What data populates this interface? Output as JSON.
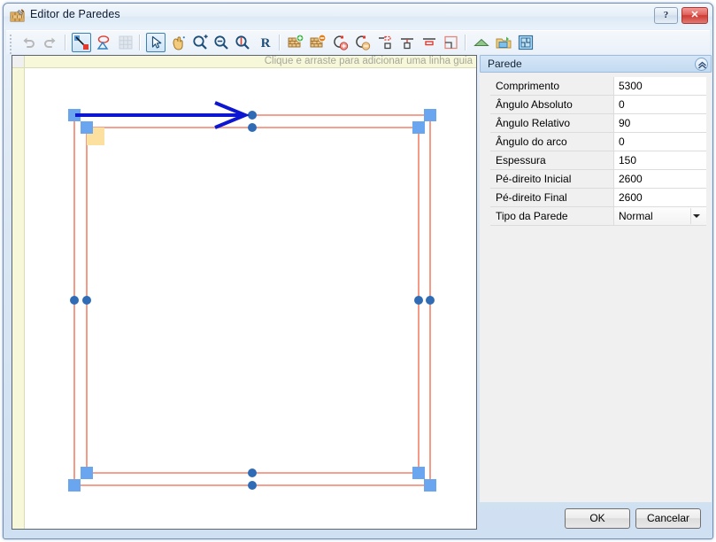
{
  "window": {
    "title": "Editor de Paredes",
    "icon": "brick-wall-icon",
    "help_label": "?",
    "close_label": "✕"
  },
  "toolbar": {
    "buttons": [
      {
        "name": "undo-button",
        "tip": "Desfazer",
        "selected": false
      },
      {
        "name": "redo-button",
        "tip": "Refazer",
        "selected": false
      },
      {
        "name": "draw-wall-button",
        "tip": "Desenhar parede",
        "selected": true
      },
      {
        "name": "draw-polygon-button",
        "tip": "Desenhar polígono",
        "selected": false
      },
      {
        "name": "grid-button",
        "tip": "Grade",
        "selected": false
      },
      {
        "name": "select-arrow-button",
        "tip": "Selecionar",
        "selected": true
      },
      {
        "name": "pan-hand-button",
        "tip": "Mover vista",
        "selected": false
      },
      {
        "name": "zoom-in-button",
        "tip": "Ampliar",
        "selected": false
      },
      {
        "name": "zoom-out-button",
        "tip": "Reduzir",
        "selected": false
      },
      {
        "name": "zoom-fit-button",
        "tip": "Ajustar zoom",
        "selected": false
      },
      {
        "name": "reset-button",
        "tip": "R",
        "selected": false
      },
      {
        "name": "add-wall-button",
        "tip": "Adicionar parede",
        "selected": false
      },
      {
        "name": "remove-wall-button",
        "tip": "Remover parede",
        "selected": false
      },
      {
        "name": "add-arc-button",
        "tip": "Adicionar arco",
        "selected": false
      },
      {
        "name": "remove-arc-button",
        "tip": "Remover arco",
        "selected": false
      },
      {
        "name": "align-top-button",
        "tip": "Alinhar acima",
        "selected": false
      },
      {
        "name": "align-center-button",
        "tip": "Alinhar centro",
        "selected": false
      },
      {
        "name": "align-bottom-button",
        "tip": "Alinhar abaixo",
        "selected": false
      },
      {
        "name": "corner-button",
        "tip": "Canto",
        "selected": false
      },
      {
        "name": "roof-button",
        "tip": "Telhado",
        "selected": false
      },
      {
        "name": "open-file-button",
        "tip": "Abrir",
        "selected": false
      },
      {
        "name": "plan-image-button",
        "tip": "Imagem de fundo",
        "selected": false
      }
    ],
    "reset_label": "R"
  },
  "canvas": {
    "ruler_hint": "Clique e arraste para adicionar uma linha guia",
    "colors": {
      "wall_line": "#f4806a",
      "handle_square": "#6aa6ef",
      "handle_circle": "#2f6cb5",
      "selected_arrow": "#0d16d0",
      "highlight_square": "#fbe0a0"
    },
    "selected_wall_direction": "horizontal-right"
  },
  "properties": {
    "header": "Parede",
    "collapse_icon": "chevron-up-icon",
    "rows": [
      {
        "label": "Comprimento",
        "value": "5300",
        "type": "text"
      },
      {
        "label": "Ângulo Absoluto",
        "value": "0",
        "type": "text"
      },
      {
        "label": "Ângulo Relativo",
        "value": "90",
        "type": "text"
      },
      {
        "label": "Ângulo do arco",
        "value": "0",
        "type": "text"
      },
      {
        "label": "Espessura",
        "value": "150",
        "type": "text"
      },
      {
        "label": "Pé-direito Inicial",
        "value": "2600",
        "type": "text"
      },
      {
        "label": "Pé-direito Final",
        "value": "2600",
        "type": "text"
      },
      {
        "label": "Tipo da Parede",
        "value": "Normal",
        "type": "combo"
      }
    ]
  },
  "footer": {
    "ok_label": "OK",
    "cancel_label": "Cancelar"
  }
}
